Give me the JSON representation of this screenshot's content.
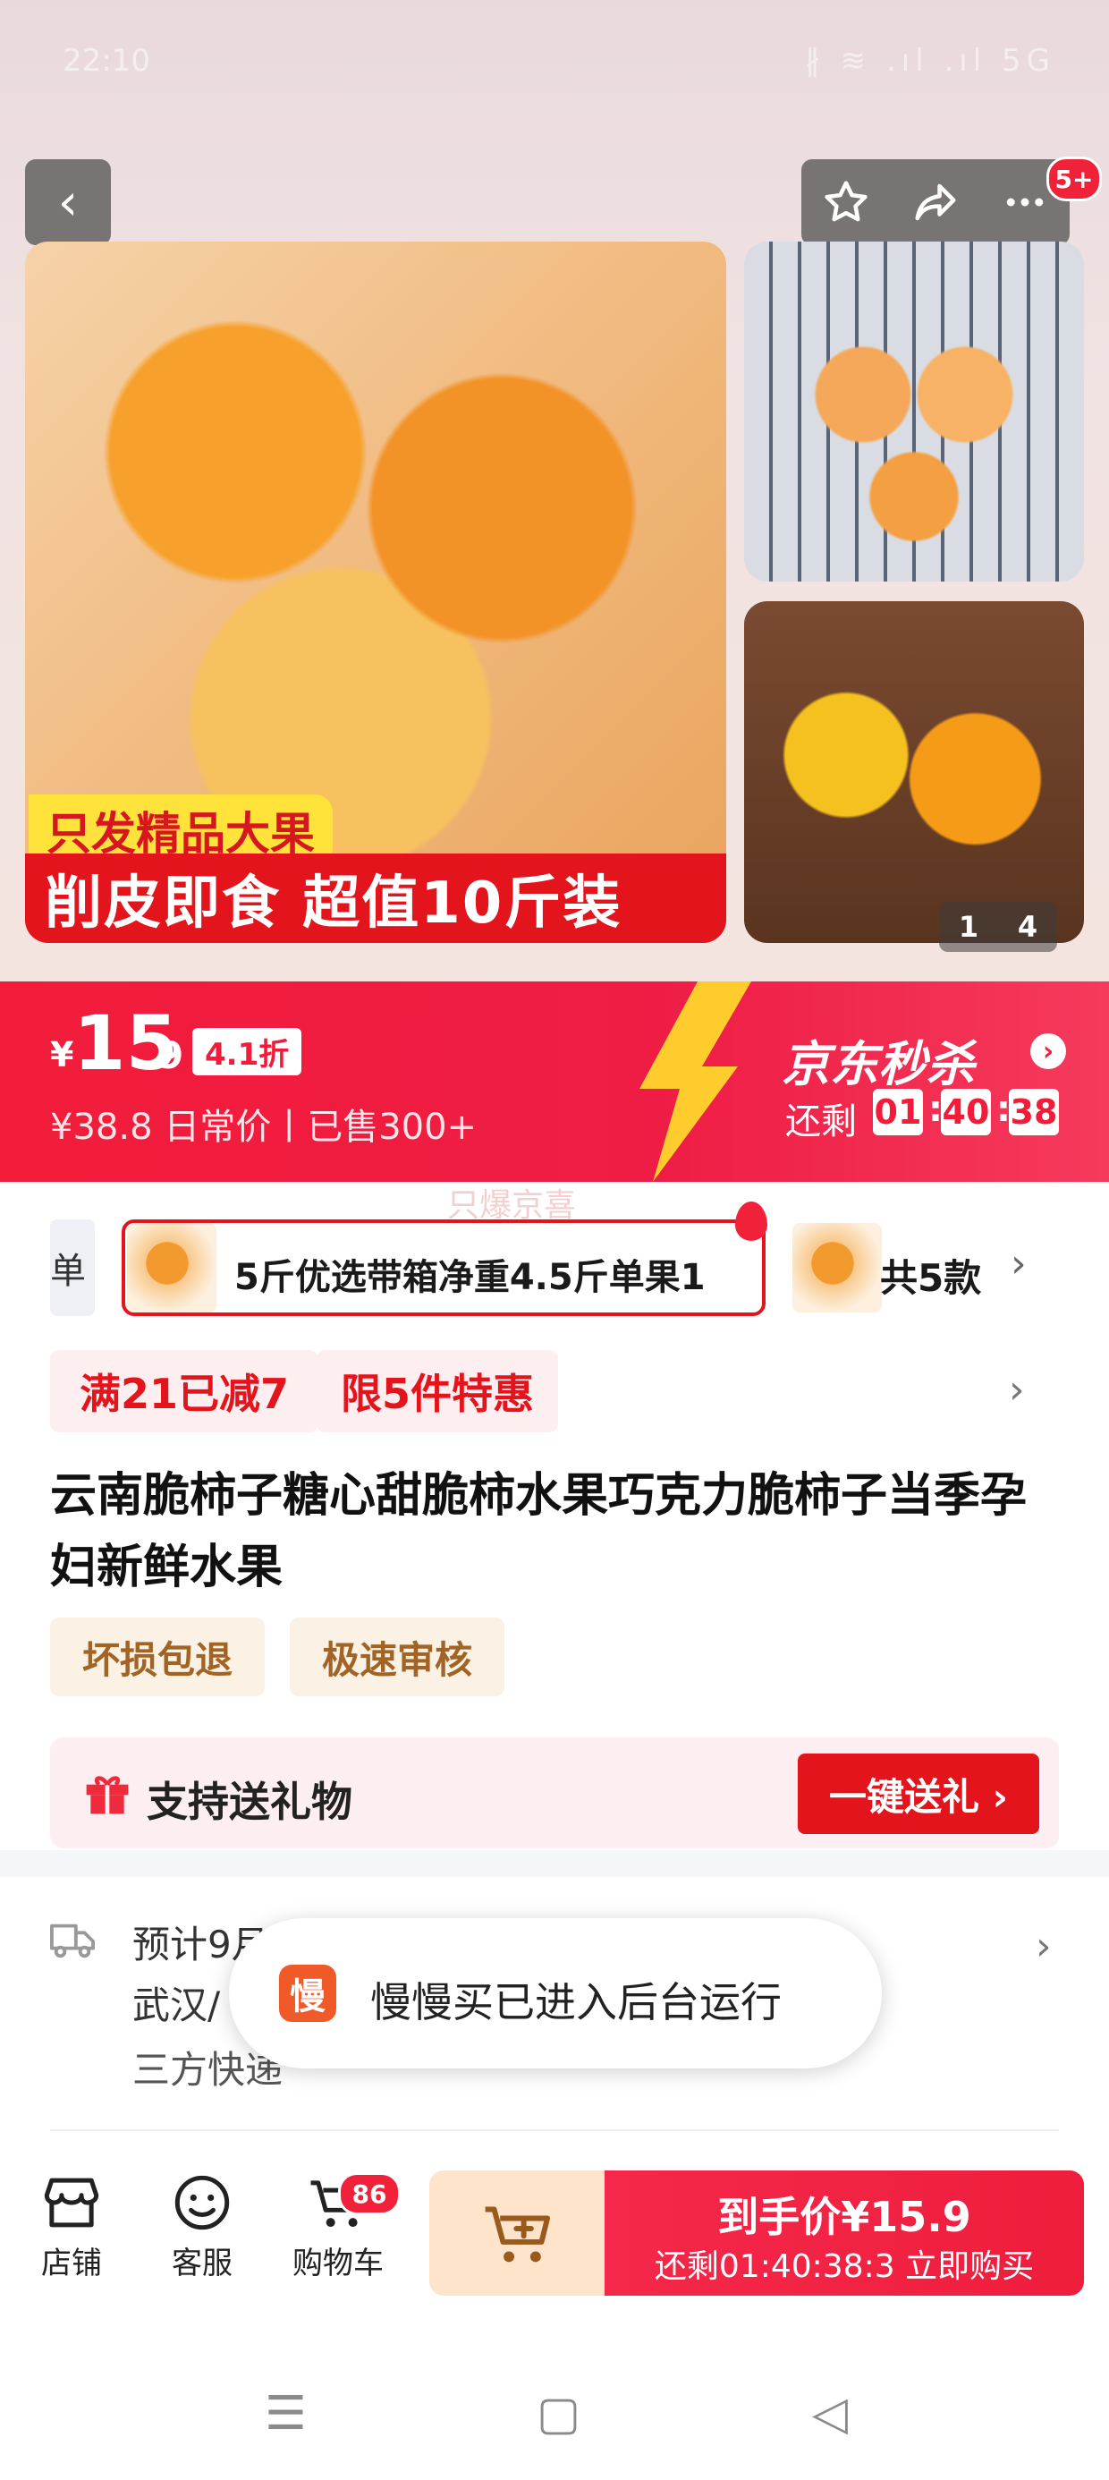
{
  "status_bar": {
    "time": "22:10",
    "indicators": "∦ ≋ .ıl .ıl 5G"
  },
  "header": {
    "back_icon": "chevron-left-icon",
    "favorite_icon": "star-icon",
    "share_icon": "share-icon",
    "more_icon": "more-icon",
    "notification_count": "5+"
  },
  "gallery": {
    "main_tag_top": "只发精品大果",
    "main_tag_bottom": "削皮即食 超值10斤装",
    "page_current": "1",
    "page_total": "4"
  },
  "price": {
    "currency": "¥",
    "integer": "15",
    "decimal": ".9",
    "discount": "4.1折",
    "original": "¥38.8 日常价丨已售300+",
    "flash_title": "京东秒杀",
    "countdown_label": "还剩",
    "countdown": {
      "h": "01",
      "m": "40",
      "s": "38"
    }
  },
  "watermark": "只爆京喜",
  "variants": {
    "prev_fragment": "单",
    "selected_label": "5斤优选带箱净重4.5斤单果1",
    "count_label": "共5款"
  },
  "promos": [
    "满21已减7",
    "限5件特惠"
  ],
  "product": {
    "title": "云南脆柿子糖心甜脆柿水果巧克力脆柿子当季孕妇新鲜水果"
  },
  "services": [
    "坏损包退",
    "极速审核"
  ],
  "gift": {
    "label": "支持送礼物",
    "button": "一键送礼 ›"
  },
  "delivery": {
    "line1": "预计9月",
    "line2": "武汉/",
    "line3": "三方快递"
  },
  "toast": {
    "icon_char": "慢",
    "text": "慢慢买已进入后台运行"
  },
  "bottom_bar": {
    "shop": "店铺",
    "service": "客服",
    "cart": "购物车",
    "cart_count": "86",
    "buy_line1": "到手价¥15.9",
    "buy_line2": "还剩01:40:38:3  立即购买"
  },
  "colors": {
    "accent": "#e3141c",
    "flash_red": "#f21c3a",
    "gift_bg": "#fdeff1",
    "service_text": "#a26425"
  }
}
